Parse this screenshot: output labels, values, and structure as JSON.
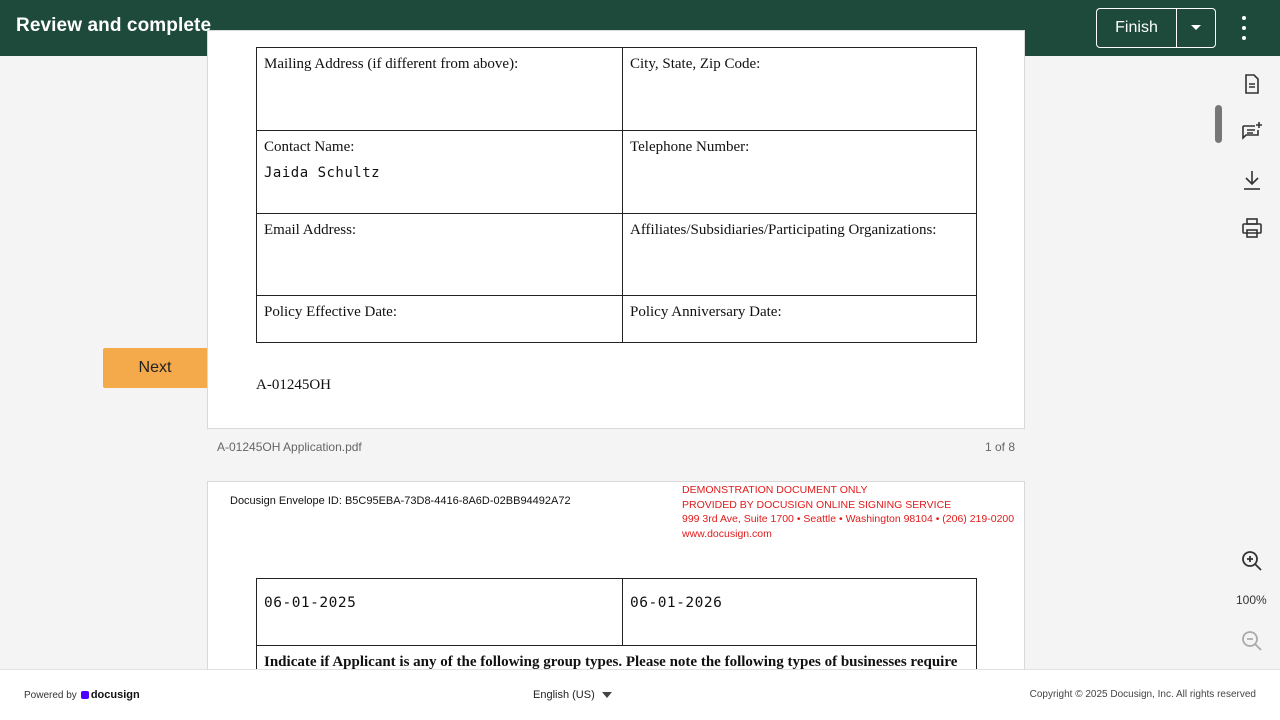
{
  "header": {
    "title": "Review and complete",
    "finish_label": "Finish"
  },
  "page1": {
    "rows": [
      {
        "left_label": "Mailing Address (if different from above):",
        "left_value": "",
        "right_label": "City, State, Zip Code:",
        "right_value": ""
      },
      {
        "left_label": "Contact Name:",
        "left_value": "Jaida Schultz",
        "right_label": "Telephone Number:",
        "right_value": ""
      },
      {
        "left_label": "Email Address:",
        "left_value": "",
        "right_label": "Affiliates/Subsidiaries/Participating Organizations:",
        "right_value": ""
      },
      {
        "left_label": "Policy Effective Date:",
        "left_value": "",
        "right_label": "Policy Anniversary Date:",
        "right_value": ""
      }
    ],
    "form_code": "A-01245OH"
  },
  "doc_footer": {
    "filename": "A-01245OH Application.pdf",
    "page_count": "1 of 8"
  },
  "page2": {
    "envelope_id": "Docusign Envelope ID: B5C95EBA-73D8-4416-8A6D-02BB94492A72",
    "demo_lines": [
      "DEMONSTRATION DOCUMENT ONLY",
      "PROVIDED BY DOCUSIGN ONLINE SIGNING SERVICE",
      "999 3rd Ave, Suite 1700  • Seattle • Washington 98104 • (206) 219-0200",
      "www.docusign.com"
    ],
    "effective_date": "06-01-2025",
    "anniversary_date": "06-01-2026",
    "group_types_text": "Indicate if Applicant is any of the following group types. Please note the following types of businesses require"
  },
  "actions": {
    "next_label": "Next"
  },
  "right_rail": {
    "icons": [
      "document-icon",
      "add-comment-icon",
      "download-icon",
      "print-icon",
      "zoom-in-icon",
      "zoom-out-icon"
    ],
    "zoom_level": "100%"
  },
  "footer": {
    "powered_by": "Powered by",
    "brand": "docusign",
    "language": "English (US)",
    "copyright": "Copyright © 2025 Docusign, Inc. All rights reserved"
  },
  "colors": {
    "header_bg": "#1e4a3c",
    "next_button": "#f4a94a",
    "demo_text": "#e01b1b",
    "brand_mark": "#4c00ff"
  }
}
